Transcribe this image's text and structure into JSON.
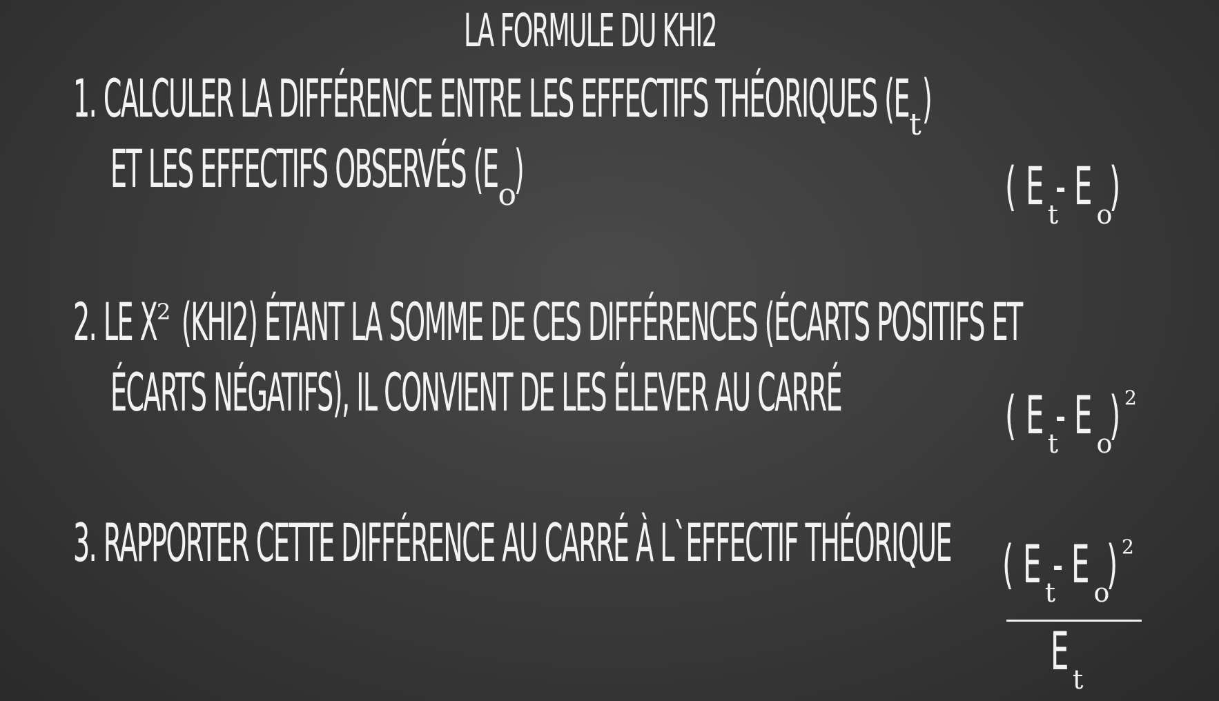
{
  "title": "La formule du Khi2",
  "steps": [
    {
      "number": "1.",
      "line1": "calculer la différence entre les effectifs théoriques (E",
      "line1_sub": "t",
      "line1_end": ")",
      "line2": "et les effectifs observés (E",
      "line2_sub": "o",
      "line2_end": ")"
    },
    {
      "number": "2.",
      "line1_pre": "Le  X",
      "line1_sup": "2",
      "line1_post": " (Khi2) étant la somme de ces différences (écarts positifs et",
      "line2": "écarts négatifs), il convient de les élever au carré"
    },
    {
      "number": "3.",
      "line1": "rapporter cette différence au carré à l`effectif théorique"
    }
  ],
  "formulas": {
    "open": "(",
    "close": ")",
    "E": "E",
    "minus": " - ",
    "sub_t": "t",
    "sub_o": "o",
    "square": "2"
  }
}
